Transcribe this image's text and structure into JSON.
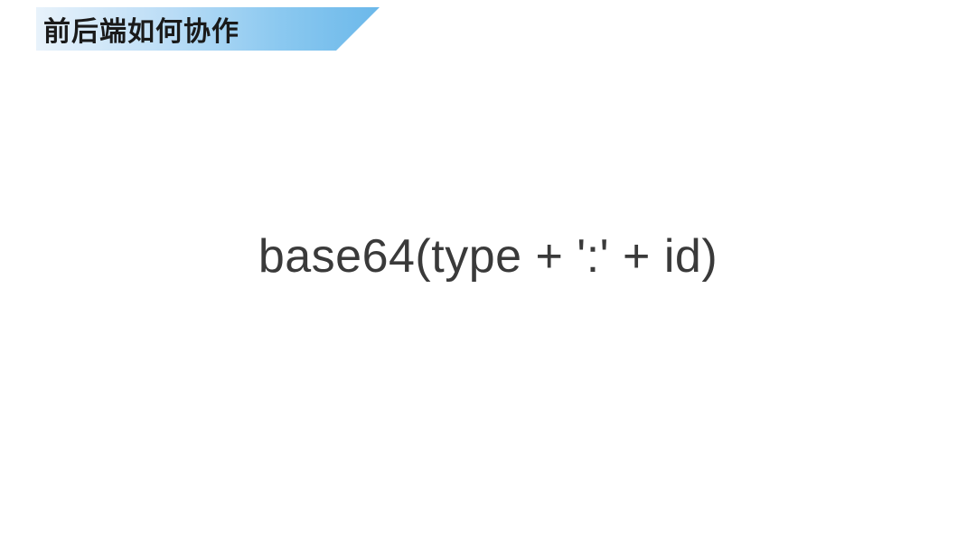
{
  "header": {
    "title": "前后端如何协作"
  },
  "main": {
    "formula": "base64(type + ':' + id)"
  }
}
